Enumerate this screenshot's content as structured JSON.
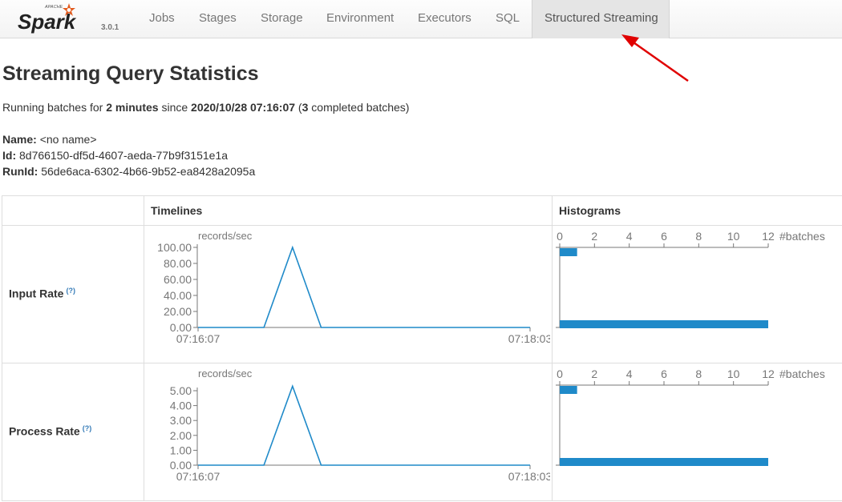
{
  "app": {
    "brand_top": "APACHE",
    "brand_name": "Spark",
    "version": "3.0.1"
  },
  "nav": {
    "tabs": [
      {
        "label": "Jobs"
      },
      {
        "label": "Stages"
      },
      {
        "label": "Storage"
      },
      {
        "label": "Environment"
      },
      {
        "label": "Executors"
      },
      {
        "label": "SQL"
      },
      {
        "label": "Structured Streaming",
        "active": true
      }
    ]
  },
  "page": {
    "title": "Streaming Query Statistics",
    "summary": {
      "prefix": "Running batches for",
      "duration": "2 minutes",
      "since_label": "since",
      "since": "2020/10/28 07:16:07",
      "open_paren": "(",
      "completed_count": "3",
      "completed_suffix": "completed batches)"
    },
    "name_label": "Name:",
    "name_value": "<no name>",
    "id_label": "Id:",
    "id_value": "8d766150-df5d-4607-aeda-77b9f3151e1a",
    "runid_label": "RunId:",
    "runid_value": "56de6aca-6302-4b66-9b52-ea8428a2095a"
  },
  "table": {
    "col_timelines": "Timelines",
    "col_histograms": "Histograms",
    "help_marker": "(?)",
    "rows": [
      {
        "label": "Input Rate"
      },
      {
        "label": "Process Rate"
      }
    ]
  },
  "accent_color": "#1f8ac9",
  "annotation_color": "#e00000",
  "chart_data": [
    {
      "type": "line",
      "title": "Input Rate timeline",
      "ylabel": "records/sec",
      "x_tick_labels": [
        "07:16:07",
        "07:18:03"
      ],
      "y_ticks": [
        "0.00",
        "20.00",
        "40.00",
        "60.00",
        "80.00",
        "100.00"
      ],
      "ylim": [
        0,
        100
      ],
      "x": [
        "07:16:07",
        "07:16:30",
        "07:16:40",
        "07:16:50",
        "07:18:03"
      ],
      "y": [
        0,
        0,
        100,
        0,
        0
      ]
    },
    {
      "type": "bar",
      "title": "Input Rate histogram",
      "xlabel": "#batches",
      "x_ticks": [
        "0",
        "2",
        "4",
        "6",
        "8",
        "10",
        "12"
      ],
      "xlim": [
        0,
        12
      ],
      "bins": [
        {
          "value_bin": "100.00",
          "count": 1
        },
        {
          "value_bin": "0.00",
          "count": 12
        }
      ]
    },
    {
      "type": "line",
      "title": "Process Rate timeline",
      "ylabel": "records/sec",
      "x_tick_labels": [
        "07:16:07",
        "07:18:03"
      ],
      "y_ticks": [
        "0.00",
        "1.00",
        "2.00",
        "3.00",
        "4.00",
        "5.00"
      ],
      "ylim": [
        0,
        5
      ],
      "x": [
        "07:16:07",
        "07:16:30",
        "07:16:40",
        "07:16:50",
        "07:18:03"
      ],
      "y": [
        0,
        0,
        5.3,
        0,
        0
      ]
    },
    {
      "type": "bar",
      "title": "Process Rate histogram",
      "xlabel": "#batches",
      "x_ticks": [
        "0",
        "2",
        "4",
        "6",
        "8",
        "10",
        "12"
      ],
      "xlim": [
        0,
        12
      ],
      "bins": [
        {
          "value_bin": "5.00",
          "count": 1
        },
        {
          "value_bin": "0.00",
          "count": 12
        }
      ]
    }
  ]
}
